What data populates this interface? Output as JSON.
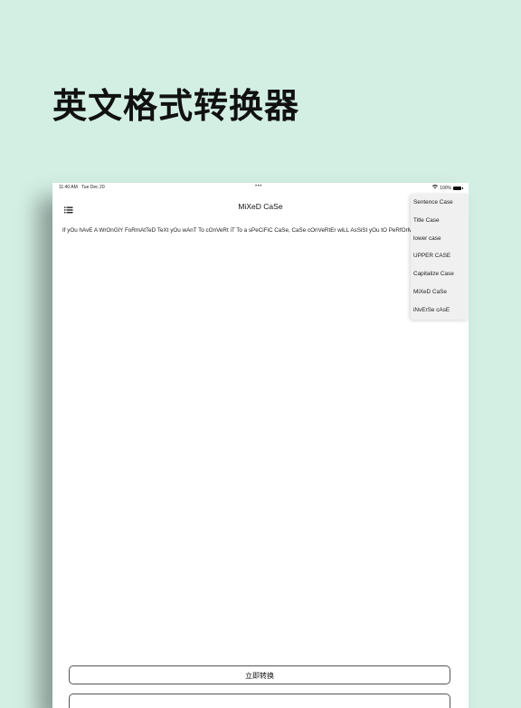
{
  "headline": "英文格式转换器",
  "status_bar": {
    "time": "11:40 AM",
    "date": "Tue Dec 20",
    "dots": "•••",
    "battery_percent": "100%"
  },
  "nav": {
    "title": "MiXeD CaSe"
  },
  "content": {
    "text": "If yOu hAvE A WrOnGlY FoRmAtTeD TeXt yOu wAnT To cOnVeRt iT To a sPeCiFiC CaSe, CaSe cOnVeRtEr wiLL AsSiSt yOu tO PeRfOrM"
  },
  "case_menu": {
    "items": [
      {
        "label": "Sentence Case"
      },
      {
        "label": "Title Case"
      },
      {
        "label": "lower case"
      },
      {
        "label": "UPPER CASE"
      },
      {
        "label": "Capitalize Case"
      },
      {
        "label": "MiXeD CaSe"
      },
      {
        "label": "iNvErSe cAsE"
      }
    ]
  },
  "actions": {
    "convert_label": "立即转换"
  }
}
